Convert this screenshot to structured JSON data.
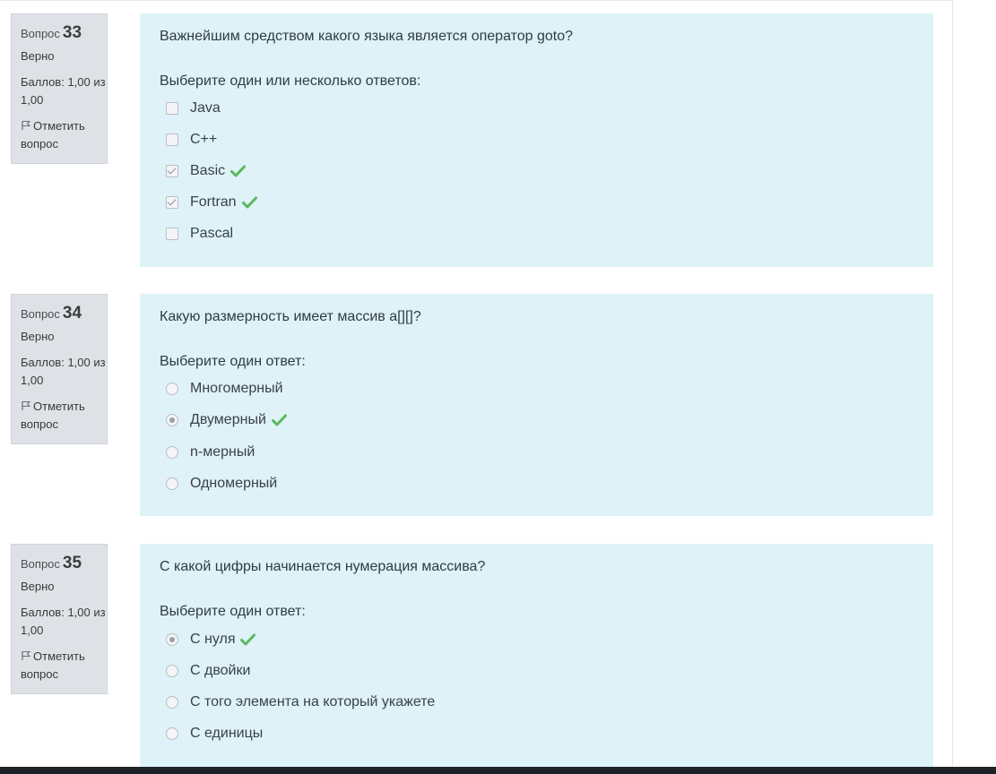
{
  "colors": {
    "correct": "#5cb85c",
    "info_bg": "#dee2e6",
    "content_bg": "#def2f8"
  },
  "questions": [
    {
      "qno_word": "Вопрос",
      "qno": "33",
      "state": "Верно",
      "grade_line1": "Баллов: 1,00 из",
      "grade_line2": "1,00",
      "flag_line1": "Отметить",
      "flag_line2": "вопрос",
      "text": "Важнейшим средством какого языка является оператор goto?",
      "prompt": "Выберите один или несколько ответов:",
      "type": "checkbox",
      "options": [
        {
          "label": "Java",
          "checked": false,
          "correct": false
        },
        {
          "label": "C++",
          "checked": false,
          "correct": false
        },
        {
          "label": "Basic",
          "checked": true,
          "correct": true
        },
        {
          "label": "Fortran",
          "checked": true,
          "correct": true
        },
        {
          "label": "Pascal",
          "checked": false,
          "correct": false
        }
      ]
    },
    {
      "qno_word": "Вопрос",
      "qno": "34",
      "state": "Верно",
      "grade_line1": "Баллов: 1,00 из",
      "grade_line2": "1,00",
      "flag_line1": "Отметить",
      "flag_line2": "вопрос",
      "text": "Какую размерность имеет массив a[][]?",
      "prompt": "Выберите один ответ:",
      "type": "radio",
      "options": [
        {
          "label": "Многомерный",
          "checked": false,
          "correct": false
        },
        {
          "label": "Двумерный",
          "checked": true,
          "correct": true
        },
        {
          "label": "n-мерный",
          "checked": false,
          "correct": false
        },
        {
          "label": "Одномерный",
          "checked": false,
          "correct": false
        }
      ]
    },
    {
      "qno_word": "Вопрос",
      "qno": "35",
      "state": "Верно",
      "grade_line1": "Баллов: 1,00 из",
      "grade_line2": "1,00",
      "flag_line1": "Отметить",
      "flag_line2": "вопрос",
      "text": "С какой цифры начинается нумерация массива?",
      "prompt": "Выберите один ответ:",
      "type": "radio",
      "options": [
        {
          "label": "С нуля",
          "checked": true,
          "correct": true
        },
        {
          "label": "С двойки",
          "checked": false,
          "correct": false
        },
        {
          "label": "С того элемента на который укажете",
          "checked": false,
          "correct": false
        },
        {
          "label": "С единицы",
          "checked": false,
          "correct": false
        }
      ]
    }
  ]
}
